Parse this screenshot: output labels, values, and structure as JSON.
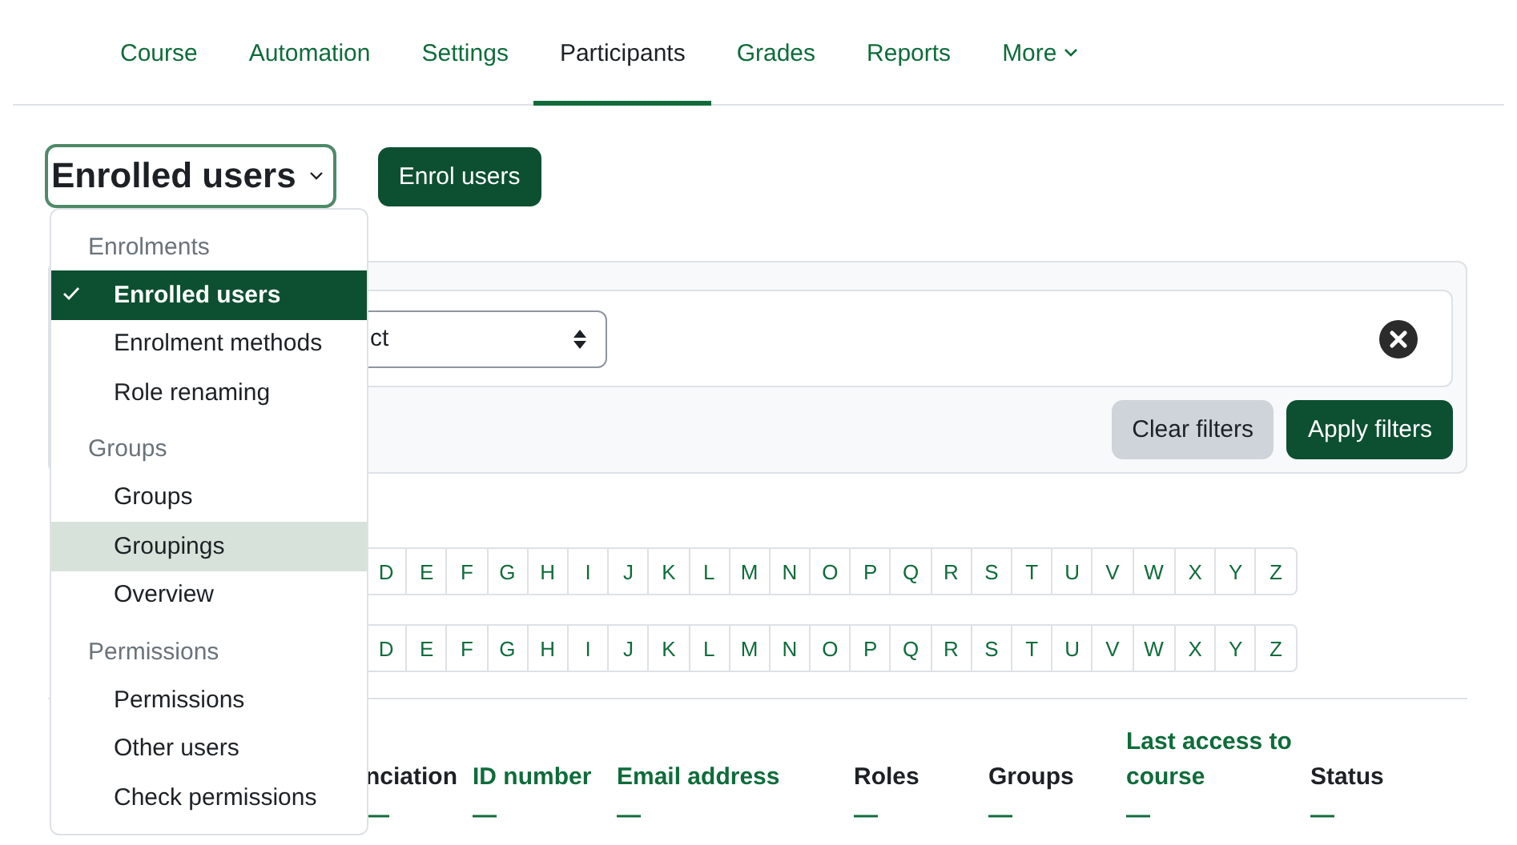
{
  "nav": {
    "tabs": [
      {
        "label": "Course",
        "selected": false
      },
      {
        "label": "Automation",
        "selected": false
      },
      {
        "label": "Settings",
        "selected": false
      },
      {
        "label": "Participants",
        "selected": true
      },
      {
        "label": "Grades",
        "selected": false
      },
      {
        "label": "Reports",
        "selected": false
      },
      {
        "label": "More",
        "selected": false,
        "dropdown": true
      }
    ]
  },
  "page_select": {
    "value": "Enrolled users",
    "expanded": true
  },
  "enrol_button": "Enrol users",
  "menu": {
    "items": [
      {
        "kind": "header",
        "label": "Enrolments"
      },
      {
        "kind": "item",
        "label": "Enrolled users",
        "selected": true,
        "highlighted": false
      },
      {
        "kind": "item",
        "label": "Enrolment methods",
        "selected": false,
        "highlighted": false
      },
      {
        "kind": "item",
        "label": "Role renaming",
        "selected": false,
        "highlighted": false
      },
      {
        "kind": "header",
        "label": "Groups"
      },
      {
        "kind": "item",
        "label": "Groups",
        "selected": false,
        "highlighted": false
      },
      {
        "kind": "item",
        "label": "Groupings",
        "selected": false,
        "highlighted": true
      },
      {
        "kind": "item",
        "label": "Overview",
        "selected": false,
        "highlighted": false
      },
      {
        "kind": "header",
        "label": "Permissions"
      },
      {
        "kind": "item",
        "label": "Permissions",
        "selected": false,
        "highlighted": false
      },
      {
        "kind": "item",
        "label": "Other users",
        "selected": false,
        "highlighted": false
      },
      {
        "kind": "item",
        "label": "Check permissions",
        "selected": false,
        "highlighted": false
      }
    ]
  },
  "filters": {
    "select_value": "ct",
    "clear_button": "Clear filters",
    "apply_button": "Apply filters"
  },
  "letter_rows": [
    [
      "D",
      "E",
      "F",
      "G",
      "H",
      "I",
      "J",
      "K",
      "L",
      "M",
      "N",
      "O",
      "P",
      "Q",
      "R",
      "S",
      "T",
      "U",
      "V",
      "W",
      "X",
      "Y",
      "Z"
    ],
    [
      "D",
      "E",
      "F",
      "G",
      "H",
      "I",
      "J",
      "K",
      "L",
      "M",
      "N",
      "O",
      "P",
      "Q",
      "R",
      "S",
      "T",
      "U",
      "V",
      "W",
      "X",
      "Y",
      "Z"
    ]
  ],
  "table": {
    "columns": [
      {
        "label": "nciation",
        "link": false,
        "mark": "—"
      },
      {
        "label": "ID number",
        "link": true,
        "mark": "—"
      },
      {
        "label": "Email address",
        "link": true,
        "mark": "—"
      },
      {
        "label": "Roles",
        "link": false,
        "mark": "—"
      },
      {
        "label": "Groups",
        "link": false,
        "mark": "—"
      },
      {
        "label": "Last access to course",
        "link": true,
        "mark": "—"
      },
      {
        "label": "Status",
        "link": false,
        "mark": "—"
      }
    ]
  }
}
